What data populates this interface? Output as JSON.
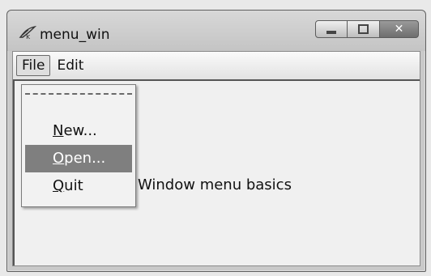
{
  "window": {
    "title": "menu_win",
    "icon": "tk-feather-icon"
  },
  "menubar": {
    "items": [
      {
        "label": "File",
        "active": true
      },
      {
        "label": "Edit",
        "active": false
      }
    ]
  },
  "file_menu": {
    "tearoff": "- - - - - - -",
    "items": [
      {
        "label": "New...",
        "underline_char": "N",
        "rest": "ew...",
        "highlighted": false
      },
      {
        "label": "Open...",
        "underline_char": "O",
        "rest": "pen...",
        "highlighted": true
      },
      {
        "label": "Quit",
        "underline_char": "Q",
        "rest": "uit",
        "highlighted": false
      }
    ]
  },
  "content": {
    "label": "Window menu basics"
  }
}
